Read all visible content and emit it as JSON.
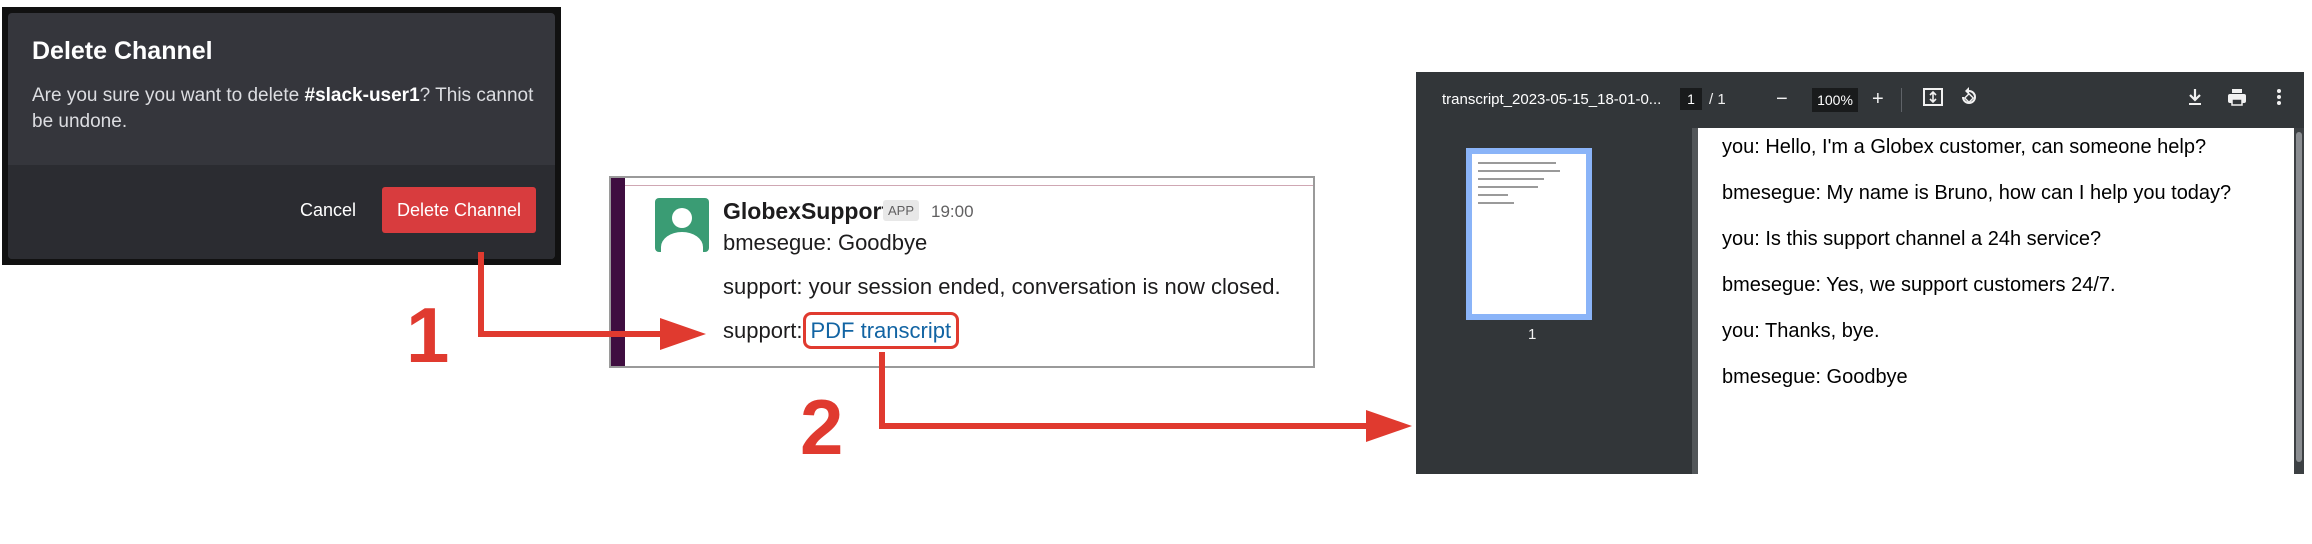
{
  "modal": {
    "title": "Delete Channel",
    "body_prefix": "Are you sure you want to delete ",
    "channel": "#slack-user1",
    "body_suffix": "? This cannot be undone.",
    "cancel_label": "Cancel",
    "delete_label": "Delete Channel"
  },
  "slack": {
    "sender": "GlobexSupport",
    "app_badge": "APP",
    "time": "19:00",
    "messages": [
      "bmesegue: Goodbye",
      "support: your session ended, conversation is now closed."
    ],
    "link_prefix": "support:",
    "link_label": "PDF transcript"
  },
  "pdf": {
    "title": "transcript_2023-05-15_18-01-0...",
    "page_current": "1",
    "page_total": "/ 1",
    "zoom": "100%",
    "thumb_page": "1",
    "lines": [
      "you: Hello, I'm a Globex customer, can someone help?",
      "bmesegue: My name is Bruno, how can I help you today?",
      "you: Is this support channel a 24h service?",
      "bmesegue: Yes, we support customers 24/7.",
      "you: Thanks, bye.",
      "bmesegue: Goodbye"
    ]
  },
  "annotations": {
    "step1": "1",
    "step2": "2",
    "color": "#e03a2f"
  }
}
